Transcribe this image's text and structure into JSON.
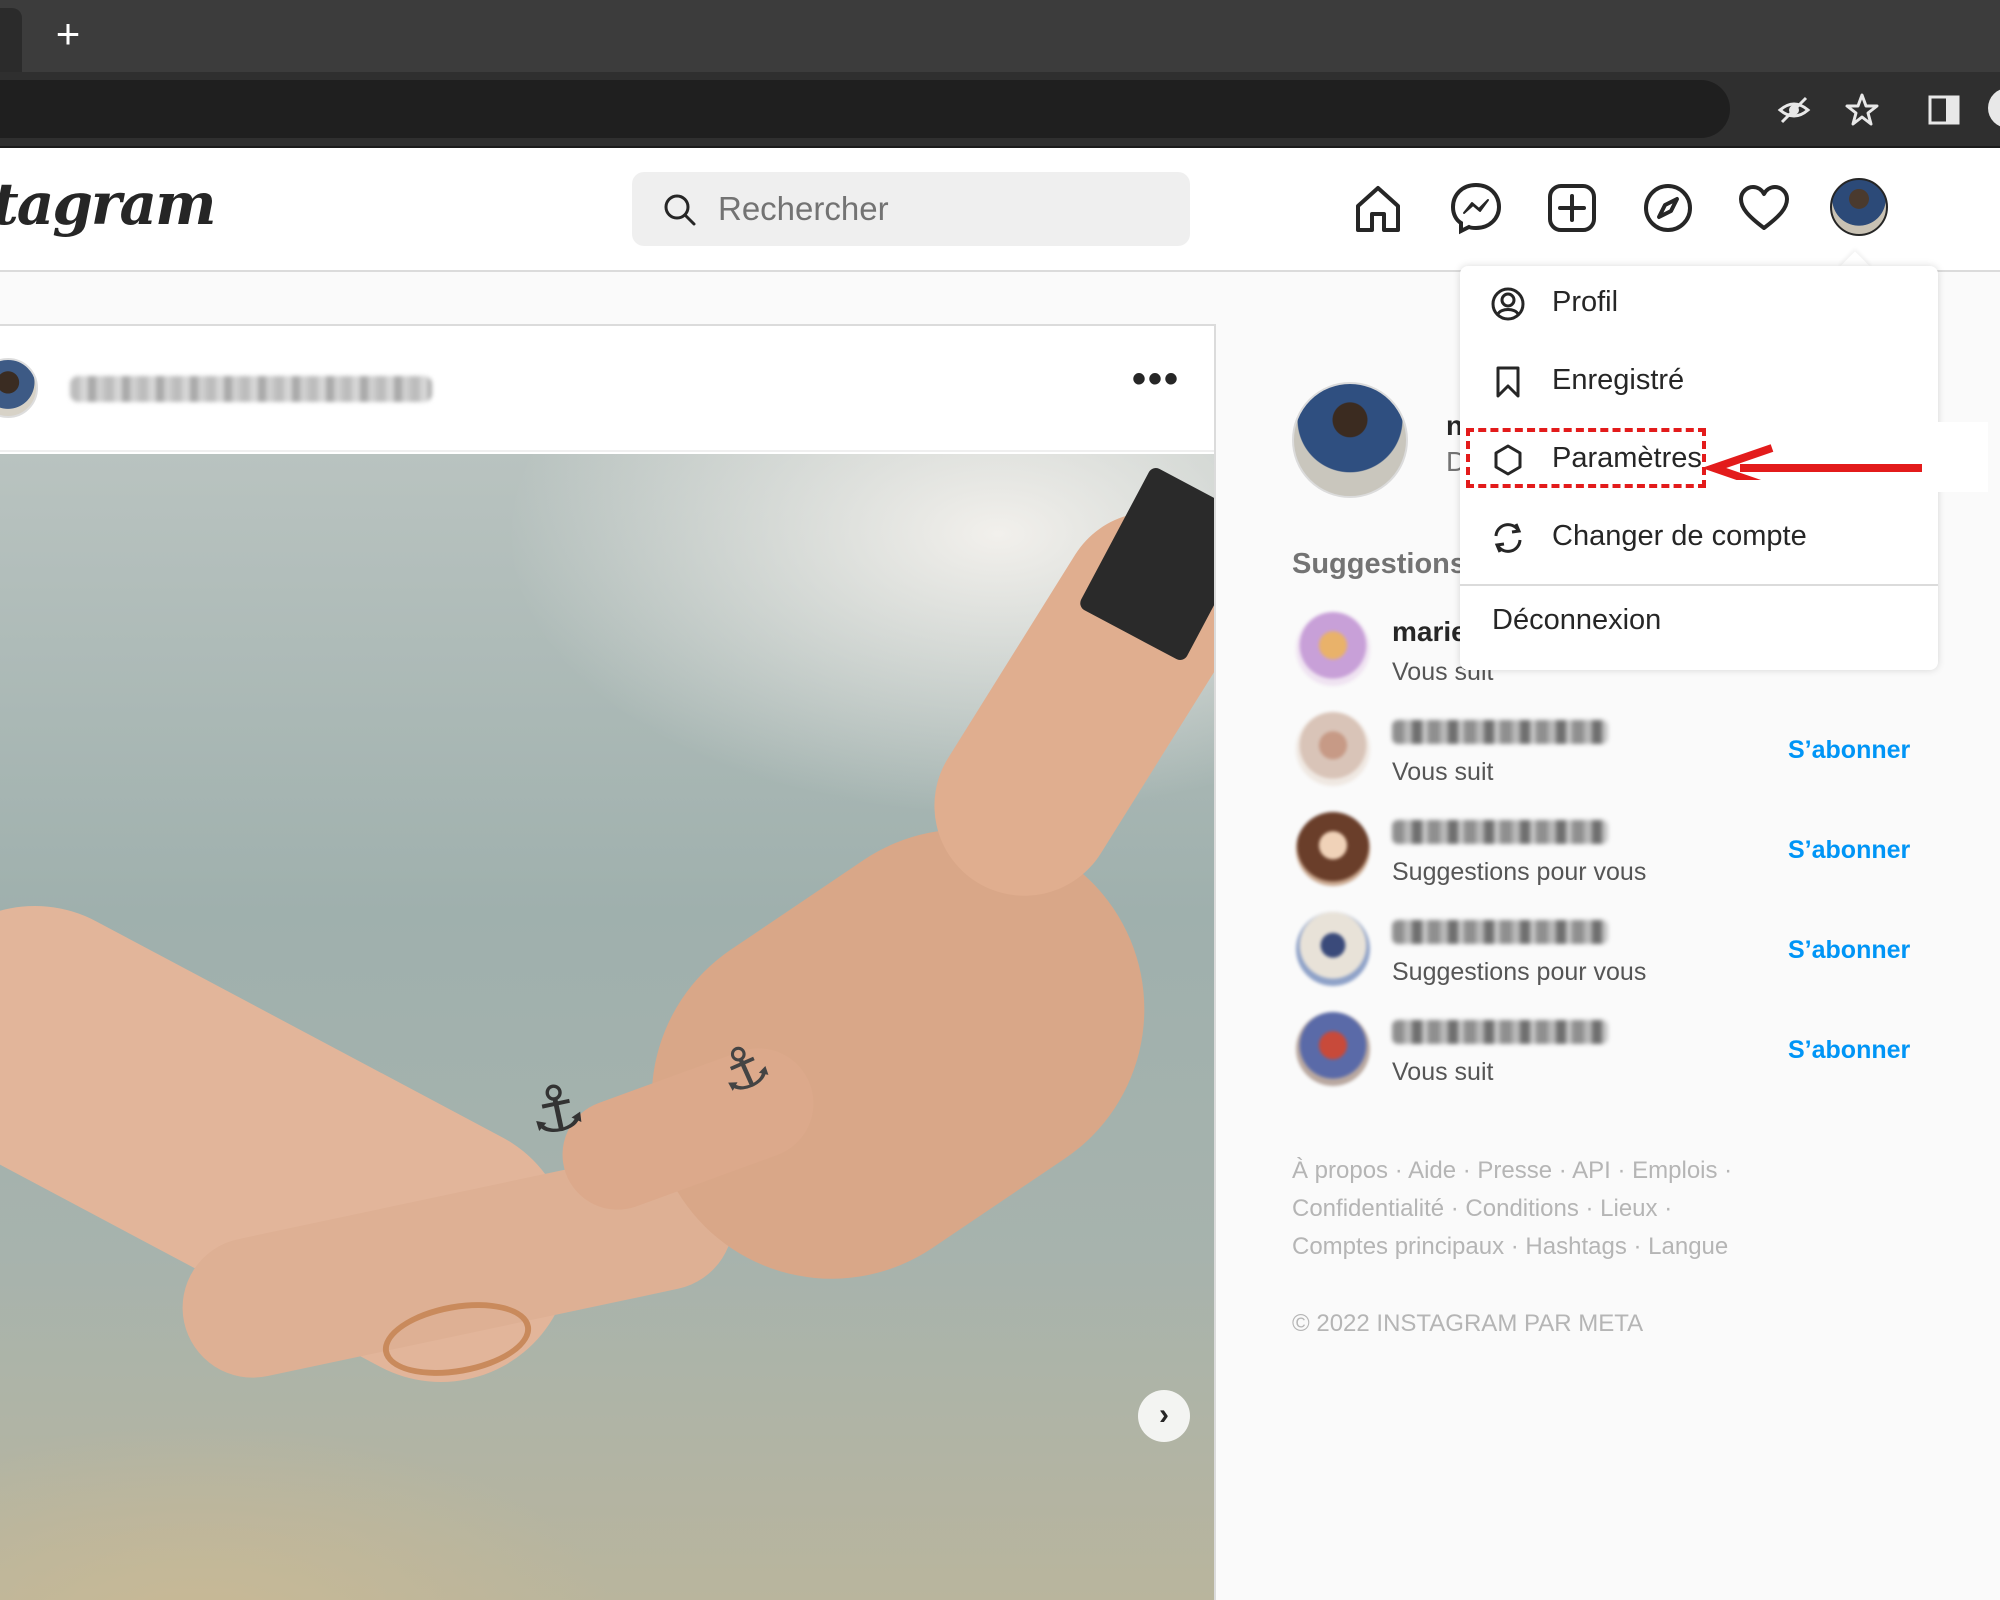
{
  "browser": {
    "new_tab_symbol": "+"
  },
  "header": {
    "logo_text": "tagram",
    "search_placeholder": "Rechercher",
    "nav_icons": [
      "home-icon",
      "messenger-icon",
      "new-post-icon",
      "explore-icon",
      "activity-heart-icon",
      "profile-avatar"
    ]
  },
  "post": {
    "more_symbol": "•••",
    "next_symbol": "›"
  },
  "sidebar": {
    "me_name": "n",
    "me_sub": "D",
    "suggestions_title": "Suggestions",
    "suggestions": [
      {
        "name": "marie",
        "sub": "Vous suit",
        "follow": ""
      },
      {
        "name": "",
        "sub": "Vous suit",
        "follow": "S’abonner"
      },
      {
        "name": "",
        "sub": "Suggestions pour vous",
        "follow": "S’abonner"
      },
      {
        "name": "",
        "sub": "Suggestions pour vous",
        "follow": "S’abonner"
      },
      {
        "name": "",
        "sub": "Vous suit",
        "follow": "S’abonner"
      }
    ],
    "footer_line1": "À propos · Aide · Presse · API · Emplois ·",
    "footer_line2": "Confidentialité · Conditions · Lieux ·",
    "footer_line3": "Comptes principaux · Hashtags · Langue",
    "copyright": "© 2022 INSTAGRAM PAR META"
  },
  "menu": {
    "items": [
      {
        "label": "Profil",
        "icon": "profile-circle-icon"
      },
      {
        "label": "Enregistré",
        "icon": "bookmark-icon"
      },
      {
        "label": "Paramètres",
        "icon": "settings-icon"
      },
      {
        "label": "Changer de compte",
        "icon": "switch-account-icon"
      }
    ],
    "logout": "Déconnexion"
  },
  "colors": {
    "accent": "#0095f6",
    "annotation": "#e31b1b"
  }
}
